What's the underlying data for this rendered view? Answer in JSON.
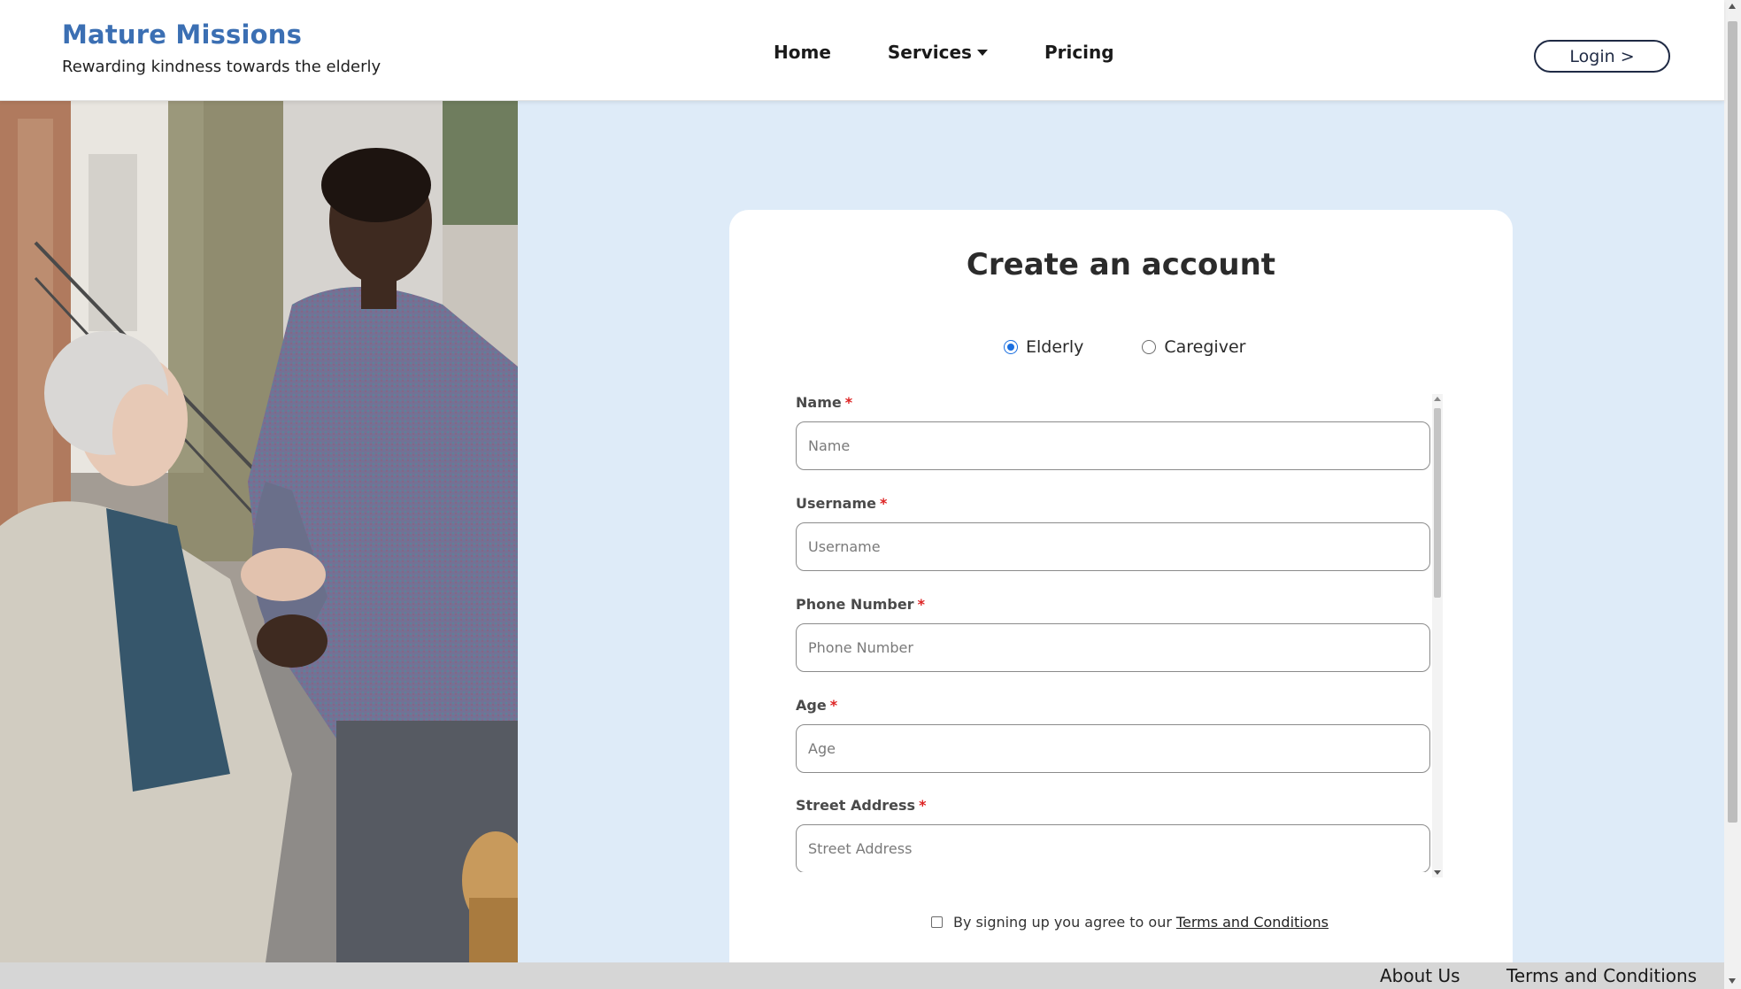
{
  "header": {
    "brand_title": "Mature Missions",
    "brand_tagline": "Rewarding kindness towards the elderly",
    "nav": {
      "home": "Home",
      "services": "Services",
      "pricing": "Pricing"
    },
    "login_label": "Login >"
  },
  "signup": {
    "title": "Create an account",
    "roles": [
      {
        "label": "Elderly",
        "selected": true
      },
      {
        "label": "Caregiver",
        "selected": false
      }
    ],
    "fields": [
      {
        "label": "Name",
        "placeholder": "Name",
        "value": ""
      },
      {
        "label": "Username",
        "placeholder": "Username",
        "value": ""
      },
      {
        "label": "Phone Number",
        "placeholder": "Phone Number",
        "value": ""
      },
      {
        "label": "Age",
        "placeholder": "Age",
        "value": ""
      },
      {
        "label": "Street Address",
        "placeholder": "Street Address",
        "value": ""
      }
    ],
    "required_marker": "*",
    "terms_text": "By signing up you agree to our",
    "terms_link": "Terms and Conditions",
    "terms_checked": false
  },
  "footer": {
    "about": "About Us",
    "terms": "Terms and Conditions"
  },
  "colors": {
    "brand": "#3b6fb3",
    "page_bg": "#deebf8",
    "radio_accent": "#1a6fe0",
    "required": "#dd2222"
  }
}
